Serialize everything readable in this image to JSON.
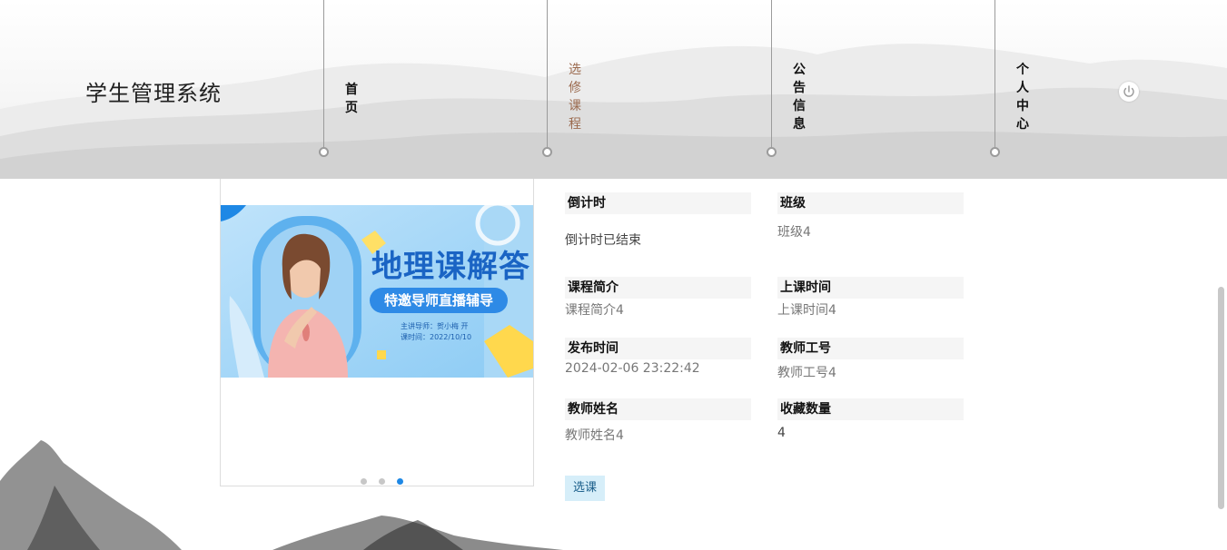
{
  "app": {
    "title": "学生管理系统"
  },
  "nav": [
    {
      "label": "首页",
      "active": false
    },
    {
      "label": "选修课程",
      "active": true
    },
    {
      "label": "公告信息",
      "active": false
    },
    {
      "label": "个人中心",
      "active": false
    }
  ],
  "banner": {
    "title": "地理课解答",
    "subtitle": "特邀导师直播辅导",
    "teacher_line": "主讲导师：贺小梅 开",
    "time_line": "课时间：2022/10/10"
  },
  "carousel": {
    "slide_count": 3,
    "active_index": 3
  },
  "details": {
    "countdown": {
      "label": "倒计时",
      "value": "倒计时已结束"
    },
    "class": {
      "label": "班级",
      "value": "班级4"
    },
    "intro": {
      "label": "课程简介",
      "value": "课程简介4"
    },
    "class_time": {
      "label": "上课时间",
      "value": "上课时间4"
    },
    "publish": {
      "label": "发布时间",
      "value": "2024-02-06 23:22:42"
    },
    "teacher_id": {
      "label": "教师工号",
      "value": "教师工号4"
    },
    "teacher": {
      "label": "教师姓名",
      "value": "教师姓名4"
    },
    "favorites": {
      "label": "收藏数量",
      "value": "4"
    }
  },
  "actions": {
    "select_label": "选课"
  },
  "icons": {
    "logout": "power-icon"
  },
  "colors": {
    "active_nav": "#9b6a4e",
    "select_button_bg": "#d6eef9",
    "dot_active": "#1e88e5"
  }
}
